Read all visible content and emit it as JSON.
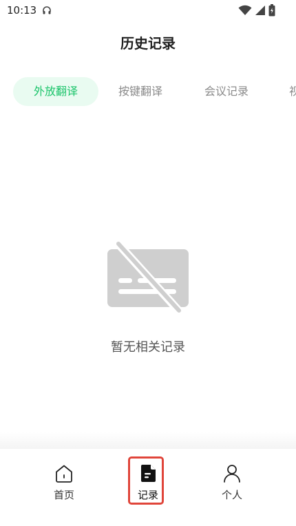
{
  "status_bar": {
    "time": "10:13"
  },
  "header": {
    "title": "历史记录"
  },
  "tabs": [
    {
      "label": "外放翻译",
      "active": true
    },
    {
      "label": "按键翻译",
      "active": false
    },
    {
      "label": "会议记录",
      "active": false
    },
    {
      "label": "视",
      "active": false
    }
  ],
  "empty_state": {
    "message": "暂无相关记录"
  },
  "bottom_nav": {
    "items": [
      {
        "label": "首页",
        "icon": "home-icon",
        "active": false
      },
      {
        "label": "记录",
        "icon": "document-icon",
        "active": true
      },
      {
        "label": "个人",
        "icon": "person-icon",
        "active": false
      }
    ]
  },
  "colors": {
    "accent": "#1cc46b",
    "accent_bg": "#e9fbf1",
    "highlight": "#e0453a",
    "illustration": "#cfcfcf"
  }
}
